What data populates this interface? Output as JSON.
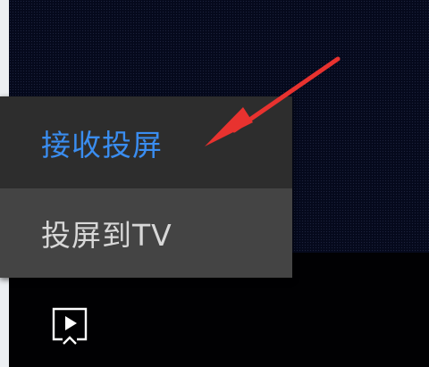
{
  "menu": {
    "items": [
      {
        "label": "接收投屏",
        "state": "highlighted"
      },
      {
        "label": "投屏到TV",
        "state": "hover"
      }
    ]
  },
  "toolbar": {
    "cast_icon": "screen-cast-icon"
  },
  "annotation": {
    "type": "red-arrow",
    "color": "#e8322f"
  },
  "colors": {
    "highlight_text": "#3a8df0",
    "menu_background": "#2d2d2d",
    "menu_hover_background": "#444444",
    "menu_text": "#d8d8d8",
    "video_background": "#05091c"
  }
}
